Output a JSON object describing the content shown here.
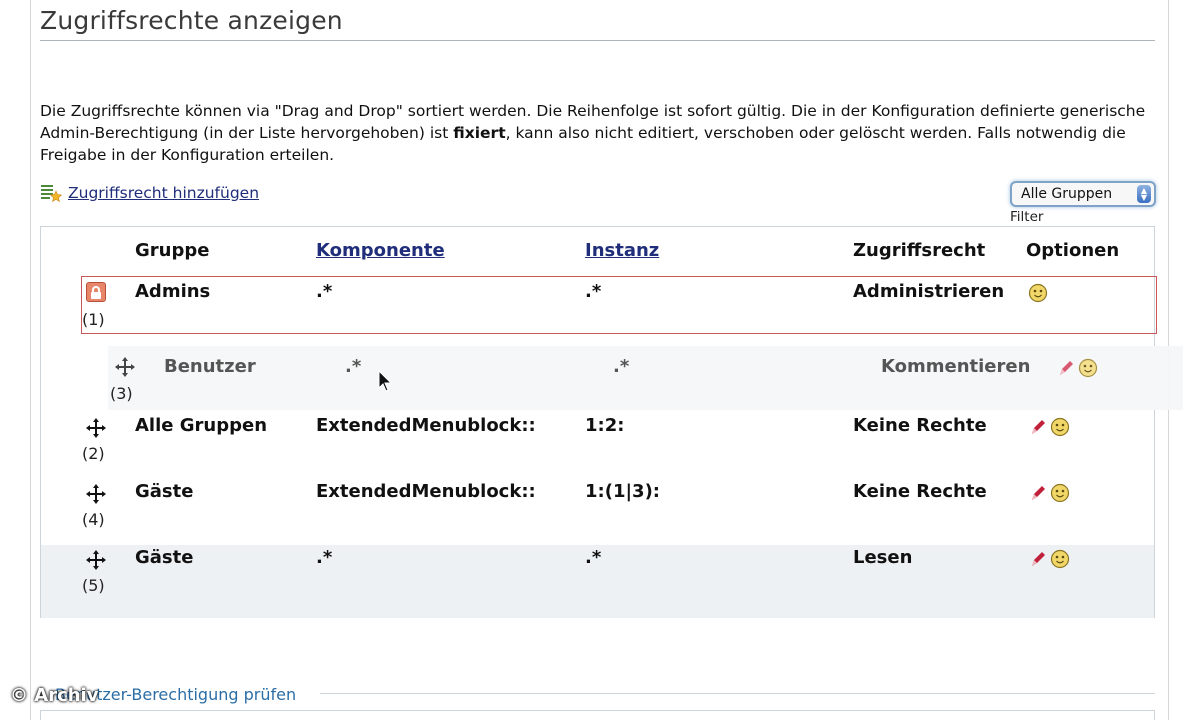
{
  "page": {
    "title": "Zugriffsrechte anzeigen",
    "description_part1": "Die Zugriffsrechte können via \"Drag and Drop\" sortiert werden. Die Reihenfolge ist sofort gültig. Die in der Konfiguration definierte generische Admin-Berechtigung (in der Liste hervorgehoben) ist ",
    "description_bold": "fixiert",
    "description_part2": ", kann also nicht editiert, verschoben oder gelöscht werden. Falls notwendig die Freigabe in der Konfiguration erteilen."
  },
  "toolbar": {
    "add_link": "Zugriffsrecht hinzufügen",
    "filter_selected": "Alle Gruppen",
    "filter_label": "Filter"
  },
  "table": {
    "headers": {
      "gruppe": "Gruppe",
      "komponente": "Komponente",
      "instanz": "Instanz",
      "zugriffsrecht": "Zugriffsrecht",
      "optionen": "Optionen"
    },
    "rows": [
      {
        "index": "(1)",
        "gruppe": "Admins",
        "komponente": ".*",
        "instanz": ".*",
        "zugriffsrecht": "Administrieren"
      },
      {
        "index": "(3)",
        "gruppe": "Benutzer",
        "komponente": ".*",
        "instanz": ".*",
        "zugriffsrecht": "Kommentieren"
      },
      {
        "index": "(2)",
        "gruppe": "Alle Gruppen",
        "komponente": "ExtendedMenublock::",
        "instanz": "1:2:",
        "zugriffsrecht": "Keine Rechte"
      },
      {
        "index": "(4)",
        "gruppe": "Gäste",
        "komponente": "ExtendedMenublock::",
        "instanz": "1:(1|3):",
        "zugriffsrecht": "Keine Rechte"
      },
      {
        "index": "(5)",
        "gruppe": "Gäste",
        "komponente": ".*",
        "instanz": ".*",
        "zugriffsrecht": "Lesen"
      }
    ]
  },
  "footer": {
    "section_title": "Benutzer-Berechtigung prüfen",
    "watermark": "© Archiv"
  },
  "colors": {
    "link": "#1f2d7a",
    "admin_border": "#c8585a",
    "edit_icon": "#c0203a",
    "info_icon": "#e8c84a"
  },
  "icons": [
    "add-permission-icon",
    "lock-icon",
    "move-icon",
    "edit-icon",
    "info-icon",
    "select-arrows-icon",
    "mouse-cursor-icon"
  ]
}
